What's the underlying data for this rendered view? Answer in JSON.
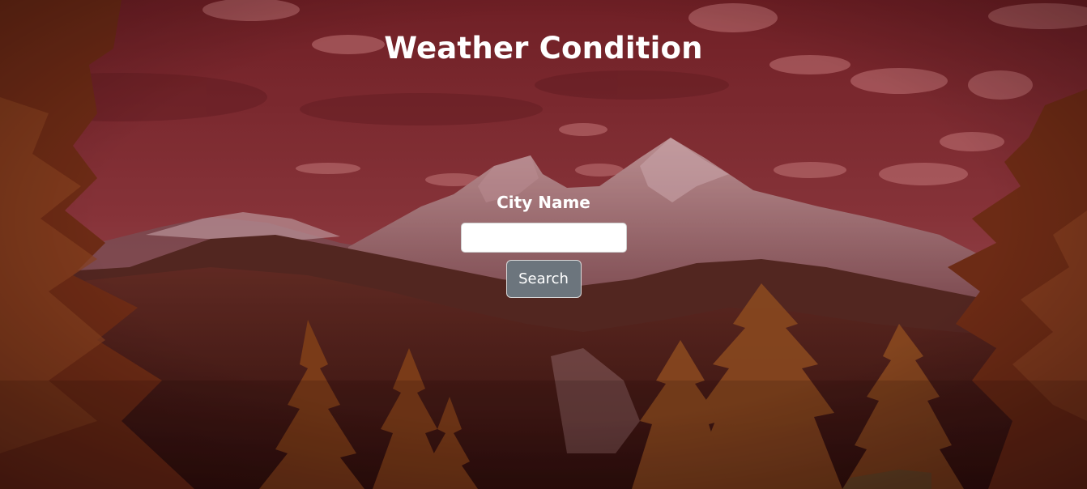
{
  "page": {
    "title": "Weather Condition"
  },
  "search_form": {
    "label": "City Name",
    "input_value": "",
    "input_placeholder": "",
    "button_label": "Search"
  },
  "colors": {
    "sky_top": "#7a2a30",
    "sky_bottom": "#a0585c",
    "mountain": "#6e4a4e",
    "forest_dark": "#2b150f",
    "tree_orange": "#8a4a1c",
    "button": "#6c757d"
  }
}
